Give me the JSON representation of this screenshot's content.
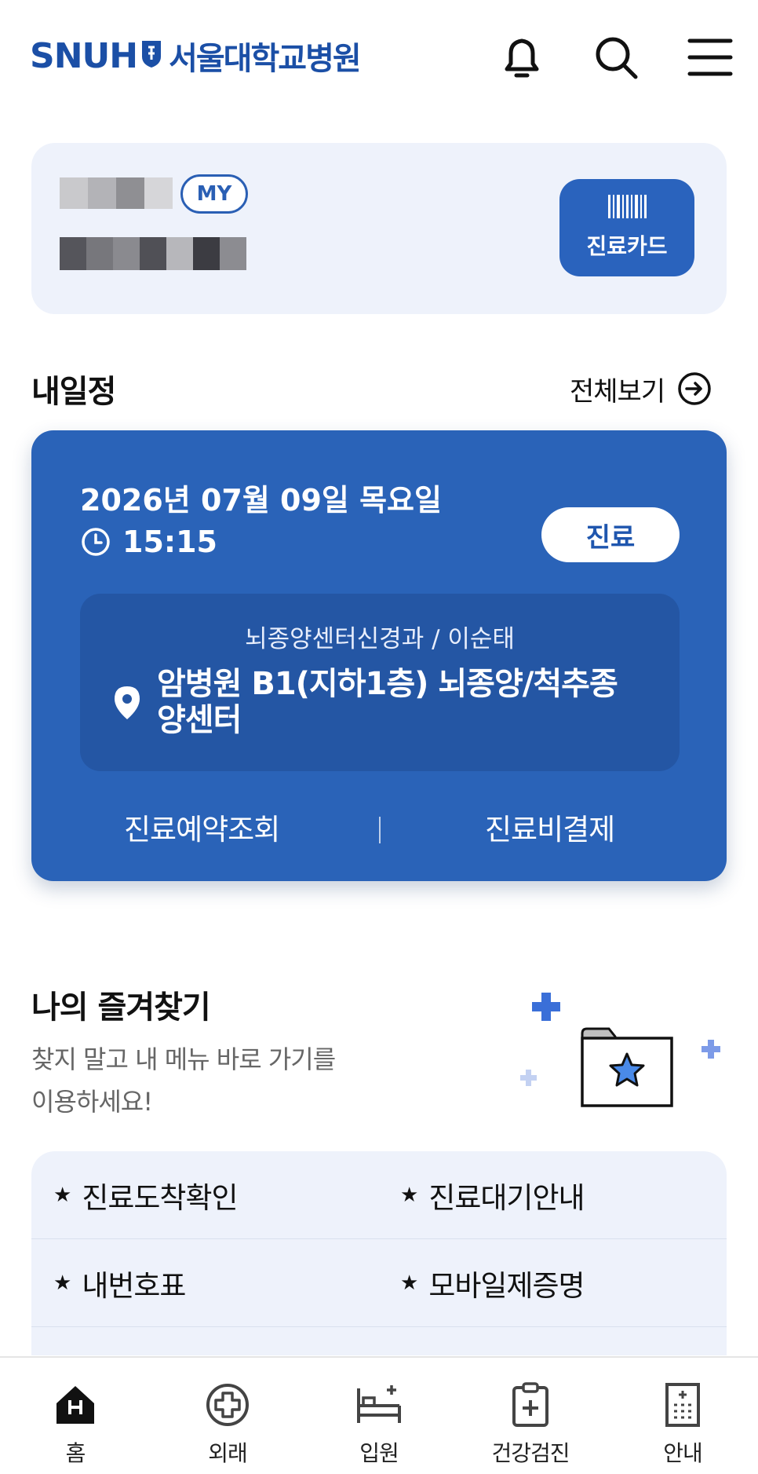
{
  "header": {
    "logo_text": "SNUH",
    "logo_name": "서울대학교병원",
    "icons": [
      "bell-icon",
      "search-icon",
      "menu-icon"
    ]
  },
  "profile": {
    "badge": "MY",
    "card_button_label": "진료카드"
  },
  "schedule": {
    "title": "내일정",
    "view_all": "전체보기",
    "date": "2026년 07월 09일 목요일",
    "time": "15:15",
    "type": "진료",
    "department": "뇌종양센터신경과 / 이순태",
    "location": "암병원 B1(지하1층) 뇌종양/척추종양센터",
    "link_left": "진료예약조회",
    "link_right": "진료비결제"
  },
  "favorites": {
    "title": "나의 즐겨찾기",
    "desc_line1": "찾지 말고 내 메뉴 바로 가기를",
    "desc_line2": "이용하세요!",
    "star": "★",
    "items": [
      "진료도착확인",
      "진료대기안내",
      "내번호표",
      "모바일제증명"
    ]
  },
  "colors": {
    "brand": "#1b4fa6",
    "card_blue": "#2a63b8",
    "soft_bg": "#eef2fb"
  },
  "nav": {
    "items": [
      {
        "label": "홈",
        "icon": "home-icon"
      },
      {
        "label": "외래",
        "icon": "outpatient-icon"
      },
      {
        "label": "입원",
        "icon": "bed-icon"
      },
      {
        "label": "건강검진",
        "icon": "clipboard-icon"
      },
      {
        "label": "안내",
        "icon": "building-icon"
      }
    ]
  }
}
